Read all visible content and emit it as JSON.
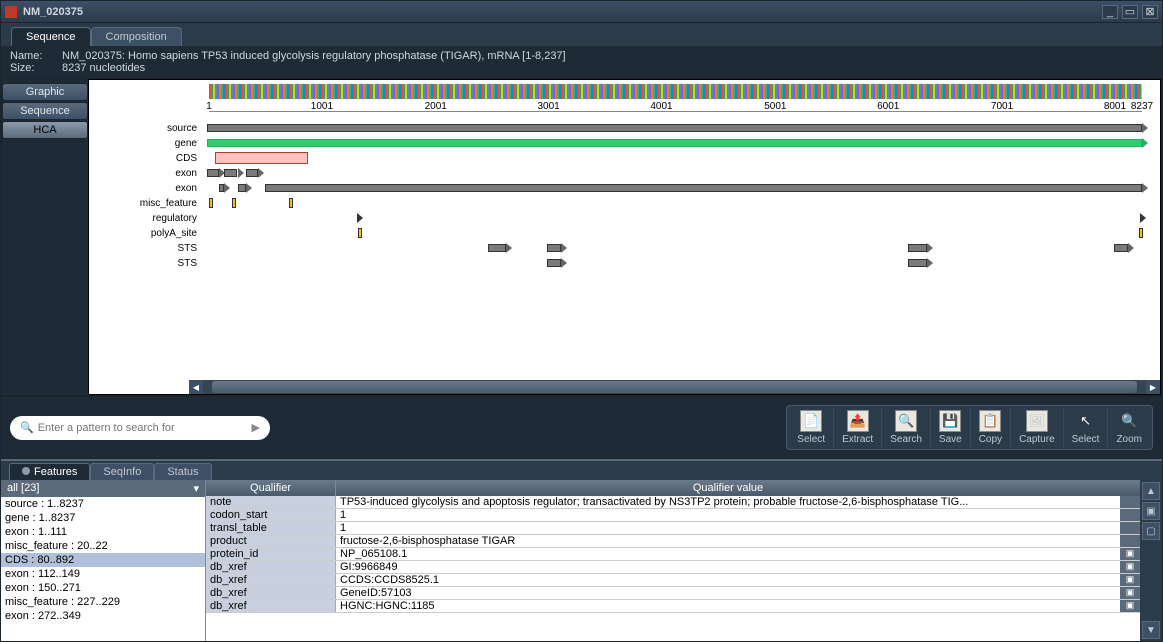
{
  "window": {
    "title": "NM_020375"
  },
  "main_tabs": [
    {
      "label": "Sequence",
      "active": true
    },
    {
      "label": "Composition",
      "active": false
    }
  ],
  "info": {
    "name_label": "Name:",
    "name_value": "NM_020375: Homo sapiens TP53 induced glycolysis regulatory phosphatase (TIGAR), mRNA [1-8,237]",
    "size_label": "Size:",
    "size_value": "8237 nucleotides"
  },
  "side_tabs": [
    {
      "label": "Graphic",
      "active": false
    },
    {
      "label": "Sequence",
      "active": false
    },
    {
      "label": "HCA",
      "active": true
    }
  ],
  "ruler": {
    "ticks": [
      "1",
      "1001",
      "2001",
      "3001",
      "4001",
      "5001",
      "6001",
      "7001",
      "8001",
      "8237"
    ]
  },
  "tracks": [
    "source",
    "gene",
    "CDS",
    "exon",
    "exon",
    "misc_feature",
    "regulatory",
    "polyA_site",
    "STS",
    "STS"
  ],
  "search": {
    "placeholder": "Enter a pattern to search for"
  },
  "tool_buttons": [
    "Select",
    "Extract",
    "Search",
    "Save",
    "Copy",
    "Capture",
    "Select",
    "Zoom"
  ],
  "bottom_tabs": [
    {
      "label": "Features",
      "active": true,
      "dot": true
    },
    {
      "label": "SeqInfo",
      "active": false,
      "dot": false
    },
    {
      "label": "Status",
      "active": false,
      "dot": false
    }
  ],
  "feature_dropdown": "all [23]",
  "feature_list": [
    {
      "label": "source : 1..8237",
      "selected": false
    },
    {
      "label": "gene : 1..8237",
      "selected": false
    },
    {
      "label": "exon : 1..111",
      "selected": false
    },
    {
      "label": "misc_feature : 20..22",
      "selected": false
    },
    {
      "label": "CDS : 80..892",
      "selected": true
    },
    {
      "label": "exon : 112..149",
      "selected": false
    },
    {
      "label": "exon : 150..271",
      "selected": false
    },
    {
      "label": "misc_feature : 227..229",
      "selected": false
    },
    {
      "label": "exon : 272..349",
      "selected": false
    }
  ],
  "qualifier_head": {
    "left": "Qualifier",
    "right": "Qualifier value"
  },
  "qualifiers": [
    {
      "name": "note",
      "value": "TP53-induced glycolysis and apoptosis regulator; transactivated by NS3TP2 protein; probable fructose-2,6-bisphosphatase TIG...",
      "action": false
    },
    {
      "name": "codon_start",
      "value": "1",
      "action": false
    },
    {
      "name": "transl_table",
      "value": "1",
      "action": false
    },
    {
      "name": "product",
      "value": "fructose-2,6-bisphosphatase TIGAR",
      "action": false
    },
    {
      "name": "protein_id",
      "value": "NP_065108.1",
      "action": true
    },
    {
      "name": "db_xref",
      "value": "GI:9966849",
      "action": true
    },
    {
      "name": "db_xref",
      "value": "CCDS:CCDS8525.1",
      "action": true
    },
    {
      "name": "db_xref",
      "value": "GeneID:57103",
      "action": true
    },
    {
      "name": "db_xref",
      "value": "HGNC:HGNC:1185",
      "action": true
    }
  ]
}
